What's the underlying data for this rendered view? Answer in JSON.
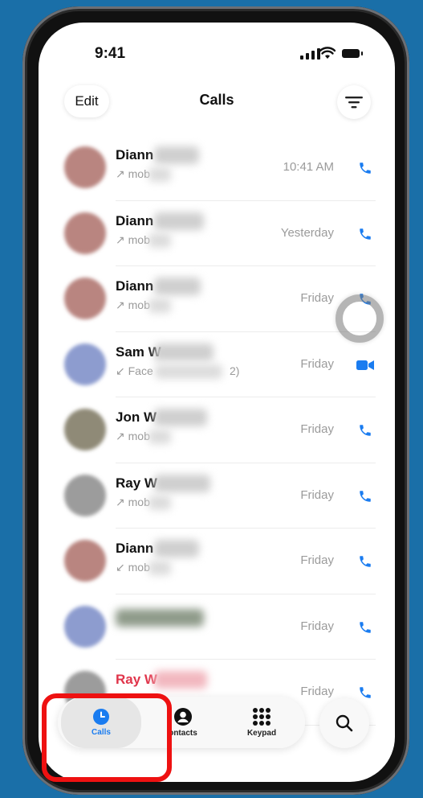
{
  "status_bar": {
    "time": "9:41"
  },
  "nav": {
    "edit_label": "Edit",
    "title": "Calls"
  },
  "calls": [
    {
      "name": "Diann",
      "detail": "↗ mob",
      "when": "10:41 AM",
      "type": "phone",
      "missed": false,
      "avatar_color": "#b98580"
    },
    {
      "name": "Diann",
      "detail": "↗ mob",
      "when": "Yesterday",
      "type": "phone",
      "missed": false,
      "avatar_color": "#b98580"
    },
    {
      "name": "Diann",
      "detail": "↗ mob",
      "when": "Friday",
      "type": "phone",
      "missed": false,
      "avatar_color": "#b98580"
    },
    {
      "name": "Sam W",
      "detail": "↙ Face",
      "detail_tail": "2)",
      "when": "Friday",
      "type": "video",
      "missed": false,
      "avatar_color": "#8d9ccf"
    },
    {
      "name": "Jon W",
      "detail": "↗ mob",
      "when": "Friday",
      "type": "phone",
      "missed": false,
      "avatar_color": "#8f8a77"
    },
    {
      "name": "Ray W",
      "detail": "↗ mob",
      "when": "Friday",
      "type": "phone",
      "missed": false,
      "avatar_color": "#9c9c9c"
    },
    {
      "name": "Diann",
      "detail": "↙ mob",
      "when": "Friday",
      "type": "phone",
      "missed": false,
      "avatar_color": "#b98580"
    },
    {
      "name": "",
      "detail": "",
      "when": "Friday",
      "type": "phone",
      "missed": false,
      "avatar_color": "#8d9ccf"
    },
    {
      "name": "Ray W",
      "detail": "",
      "when": "Friday",
      "type": "phone",
      "missed": true,
      "avatar_color": "#9c9c9c"
    }
  ],
  "tabs": [
    {
      "label": "Calls",
      "icon": "clock-icon",
      "active": true
    },
    {
      "label": "ontacts",
      "icon": "person-icon",
      "active": false
    },
    {
      "label": "Keypad",
      "icon": "keypad-icon",
      "active": false
    }
  ],
  "colors": {
    "accent": "#1a7cf0",
    "missed": "#e0344a",
    "highlight": "#ee1111"
  }
}
